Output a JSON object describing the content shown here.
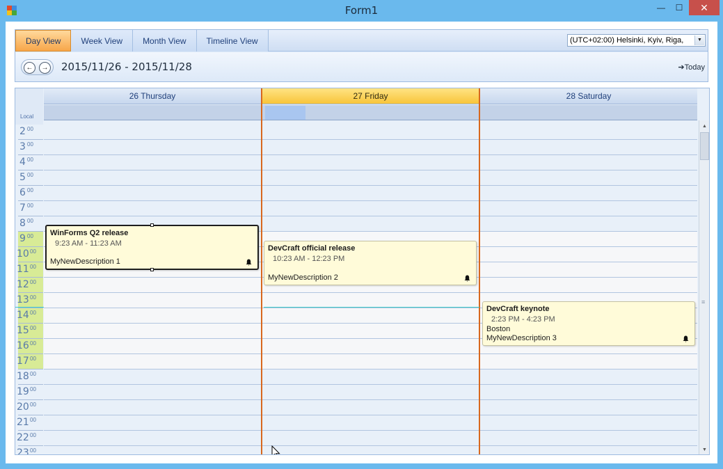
{
  "window": {
    "title": "Form1",
    "close_glyph": "✕",
    "minimize_glyph": "—",
    "maximize_glyph": "☐"
  },
  "view_tabs": [
    {
      "label": "Day View",
      "active": true
    },
    {
      "label": "Week View",
      "active": false
    },
    {
      "label": "Month View",
      "active": false
    },
    {
      "label": "Timeline View",
      "active": false
    }
  ],
  "timezone": {
    "selected": "(UTC+02:00) Helsinki, Kyiv, Riga,",
    "arrow_glyph": "▼"
  },
  "navigator": {
    "range": "2015/11/26 - 2015/11/28",
    "prev_glyph": "←",
    "next_glyph": "→",
    "today_label": "➔Today"
  },
  "ruler": {
    "label": "Local",
    "hours": [
      "2",
      "3",
      "4",
      "5",
      "6",
      "7",
      "8",
      "9",
      "10",
      "11",
      "12",
      "13",
      "14",
      "15",
      "16",
      "17",
      "18",
      "19",
      "20",
      "21",
      "22",
      "23"
    ],
    "minutes": "00"
  },
  "days": [
    {
      "label": "26 Thursday",
      "today": false
    },
    {
      "label": "27 Friday",
      "today": true
    },
    {
      "label": "28 Saturday",
      "today": false
    }
  ],
  "appointments": [
    {
      "subject": "WinForms Q2 release",
      "time": "9:23 AM  -  11:23 AM",
      "location": "",
      "description": "MyNewDescription 1",
      "selected": true
    },
    {
      "subject": "DevCraft official release",
      "time": "10:23 AM  -  12:23 PM",
      "location": "",
      "description": "MyNewDescription 2",
      "selected": false
    },
    {
      "subject": "DevCraft keynote",
      "time": "2:23 PM  -  4:23 PM",
      "location": "Boston",
      "description": "MyNewDescription 3",
      "selected": false
    }
  ],
  "scrollbar": {
    "up_glyph": "▲",
    "down_glyph": "▼",
    "grip_glyph": "≡"
  },
  "colors": {
    "accent_today": "#f8c43a",
    "work_hours": "#d8eb96",
    "column_border": "#d8681e",
    "current_time": "#3fc8c7",
    "selected_tab": "#f7a64a"
  },
  "icons": [
    "app-icon",
    "bell-icon",
    "prev-arrow-icon",
    "next-arrow-icon",
    "mouse-cursor-icon"
  ]
}
